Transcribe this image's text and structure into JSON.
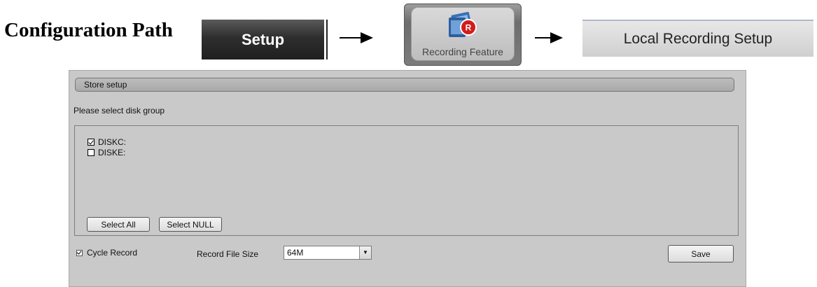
{
  "header": {
    "path_label": "Configuration Path",
    "setup_label": "Setup",
    "recording_feature_label": "Recording Feature",
    "recording_feature_icon": "film-record-icon",
    "local_recording_label": "Local Recording Setup"
  },
  "panel": {
    "section_title": "Store setup",
    "prompt": "Please select disk group",
    "disks": [
      {
        "label": "DISKC:",
        "checked": true
      },
      {
        "label": "DISKE:",
        "checked": false
      }
    ],
    "select_all_label": "Select All",
    "select_null_label": "Select NULL",
    "cycle_record_label": "Cycle Record",
    "cycle_record_checked": true,
    "record_file_size_label": "Record File Size",
    "record_file_size_value": "64M",
    "save_label": "Save"
  },
  "colors": {
    "panel_bg": "#c9c9c9",
    "setup_bg": "#2e2e2e",
    "record_red": "#d41c1c"
  }
}
